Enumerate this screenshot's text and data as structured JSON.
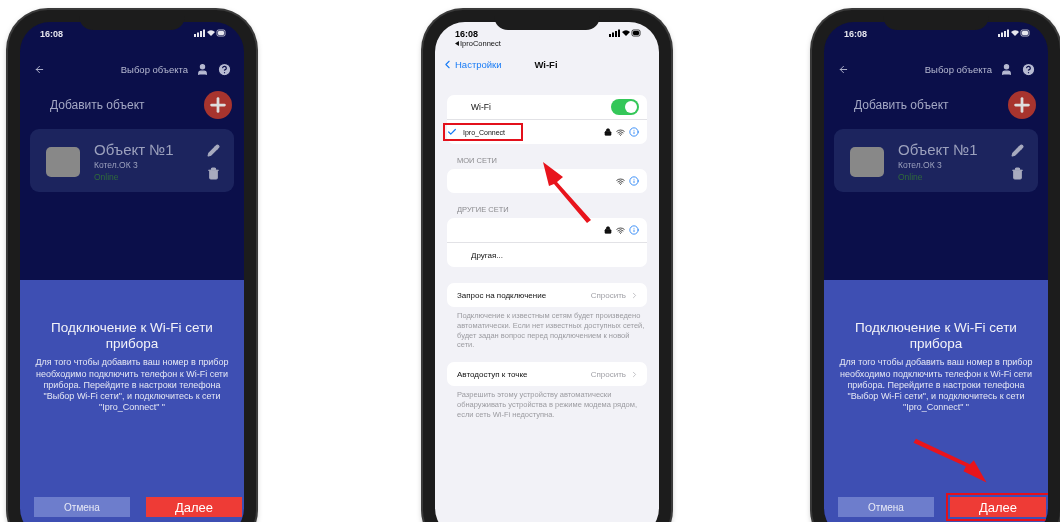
{
  "phones": [
    {
      "kind": "app",
      "time": "16:08",
      "header_title": "Выбор объекта",
      "add_label": "Добавить объект",
      "object": {
        "name": "Объект №1",
        "model": "Котел.ОК 3",
        "status": "Online"
      },
      "dialog": {
        "title": "Подключение к Wi-Fi сети прибора",
        "text": "Для того чтобы добавить ваш номер в прибор необходимо подключить телефон к Wi-Fi сети прибора. Перейдите в настроки телефона \"Выбор Wi-Fi сети\", и подключитесь к сети \"Ipro_Connect\"  \"",
        "buttons": [
          {
            "label": "Отмена",
            "kind": "secondary",
            "highlighted": false
          },
          {
            "label": "Далее",
            "kind": "primary",
            "highlighted": false
          }
        ]
      }
    },
    {
      "kind": "settings",
      "time": "16:08",
      "back_app": "IproConnect",
      "back_label": "Настройки",
      "title": "Wi-Fi",
      "wifi": {
        "label": "Wi-Fi",
        "on": true
      },
      "current": {
        "name": "Ipro_Connect",
        "selected": true,
        "locked": true,
        "highlighted": true
      },
      "sections": [
        {
          "header": "МОИ СЕТИ",
          "networks": [
            {
              "locked": false
            }
          ]
        },
        {
          "header": "ДРУГИЕ СЕТИ",
          "networks": [
            {
              "locked": true
            }
          ],
          "other": "Другая..."
        }
      ],
      "options": [
        {
          "label": "Запрос на подключение",
          "value": "Спросить",
          "note": "Подключение к известным сетям будет произведено автоматически. Если нет известных доступных сетей, будет задан вопрос перед подключением к новой сети."
        },
        {
          "label": "Автодоступ к точке",
          "value": "Спросить",
          "note": "Разрешить этому устройству автоматически обнаруживать устройства в режиме модема рядом, если сеть Wi-Fi недоступна."
        }
      ]
    },
    {
      "kind": "app",
      "time": "16:08",
      "header_title": "Выбор объекта",
      "add_label": "Добавить объект",
      "object": {
        "name": "Объект №1",
        "model": "Котел.ОК 3",
        "status": "Online"
      },
      "dialog": {
        "title": "Подключение к Wi-Fi сети прибора",
        "text": "Для того чтобы добавить ваш номер в прибор необходимо подключить телефон к Wi-Fi сети прибора. Перейдите в настроки телефона \"Выбор Wi-Fi сети\", и подключитесь к сети \"Ipro_Connect\"  \"",
        "buttons": [
          {
            "label": "Отмена",
            "kind": "secondary",
            "highlighted": false
          },
          {
            "label": "Далее",
            "kind": "primary",
            "highlighted": true
          }
        ]
      }
    }
  ]
}
